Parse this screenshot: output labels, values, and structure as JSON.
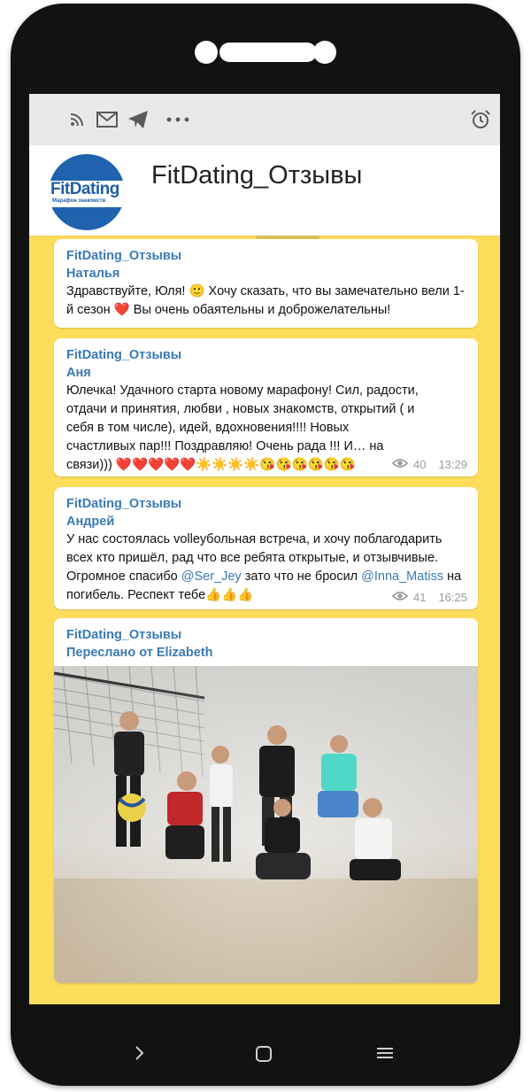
{
  "header": {
    "channel_name": "FitDating_Отзывы",
    "avatar": {
      "logo_text": "FitDating",
      "logo_subtext": "Марафон знакомств"
    }
  },
  "topbar_icons": [
    "rss-icon",
    "mail-icon",
    "telegram-icon",
    "more-icon",
    "alarm-icon"
  ],
  "messages": [
    {
      "channel": "FitDating_Отзывы",
      "author": "Наталья",
      "text": "Здравствуйте, Юля! 🙂 Хочу сказать, что вы замечательно вели 1-й сезон ❤️ Вы очень обаятельны и доброжелательны!"
    },
    {
      "channel": "FitDating_Отзывы",
      "author": "Аня",
      "text": "Юлечка! Удачного старта новому марафону! Сил, радости, отдачи и принятия, любви , новых знакомств, открытий ( и себя в том числе), идей, вдохновения!!!! Новых счастливых пар!!! Поздравляю! Очень рада !!! И… на связи))) ❤️❤️❤️❤️❤️☀️☀️☀️☀️😘😘😘😘😘😘",
      "views": "40",
      "time": "13:29"
    },
    {
      "channel": "FitDating_Отзывы",
      "author": "Андрей",
      "text_before": "У нас состоялась volleyбольная встреча, и хочу поблагодарить всех кто пришёл, рад что все ребята открытые, и отзывчивые. Огромное спасибо ",
      "mention1": "@Ser_Jey",
      "text_middle": " зато что не бросил ",
      "mention2": "@Inna_Matiss",
      "text_after": " на погибель. Респект тебе👍👍👍",
      "views": "41",
      "time": "16:25"
    },
    {
      "channel": "FitDating_Отзывы",
      "forwarded": "Переслано от Elizabeth"
    }
  ],
  "colors": {
    "chat_background": "#ffdd5c",
    "link_blue": "#3a7ab5",
    "phone_body": "#121212"
  },
  "navbar_icons": [
    "back-chevron-icon",
    "home-icon",
    "menu-icon"
  ]
}
